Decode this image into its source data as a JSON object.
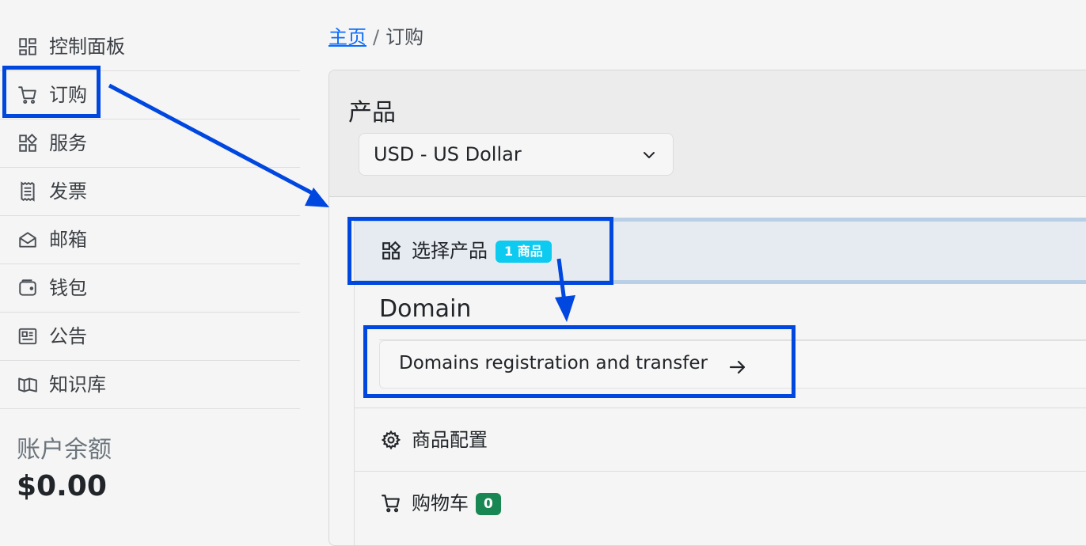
{
  "sidebar": {
    "items": [
      {
        "label": "控制面板",
        "icon": "dashboard-icon"
      },
      {
        "label": "订购",
        "icon": "cart-icon"
      },
      {
        "label": "服务",
        "icon": "services-icon"
      },
      {
        "label": "发票",
        "icon": "invoice-icon"
      },
      {
        "label": "邮箱",
        "icon": "mail-icon"
      },
      {
        "label": "钱包",
        "icon": "wallet-icon"
      },
      {
        "label": "公告",
        "icon": "news-icon"
      },
      {
        "label": "知识库",
        "icon": "book-icon"
      }
    ],
    "balance_label": "账户余额",
    "balance_value": "$0.00"
  },
  "breadcrumb": {
    "home": "主页",
    "separator": "/",
    "current": "订购"
  },
  "products": {
    "title": "产品",
    "currency_selected": "USD - US Dollar"
  },
  "steps": {
    "select_product": {
      "label": "选择产品",
      "badge": "1 商品",
      "icon": "grid-plus-icon"
    },
    "domain_group": {
      "title": "Domain",
      "link_text": "Domains registration and transfer"
    },
    "config": {
      "label": "商品配置",
      "icon": "gear-icon"
    },
    "cart": {
      "label": "购物车",
      "badge": "0",
      "icon": "cart-icon"
    }
  },
  "colors": {
    "annotation": "#0047e0",
    "badge_info": "#0dcaf0",
    "badge_success": "#198754",
    "link": "#0d6efd"
  }
}
